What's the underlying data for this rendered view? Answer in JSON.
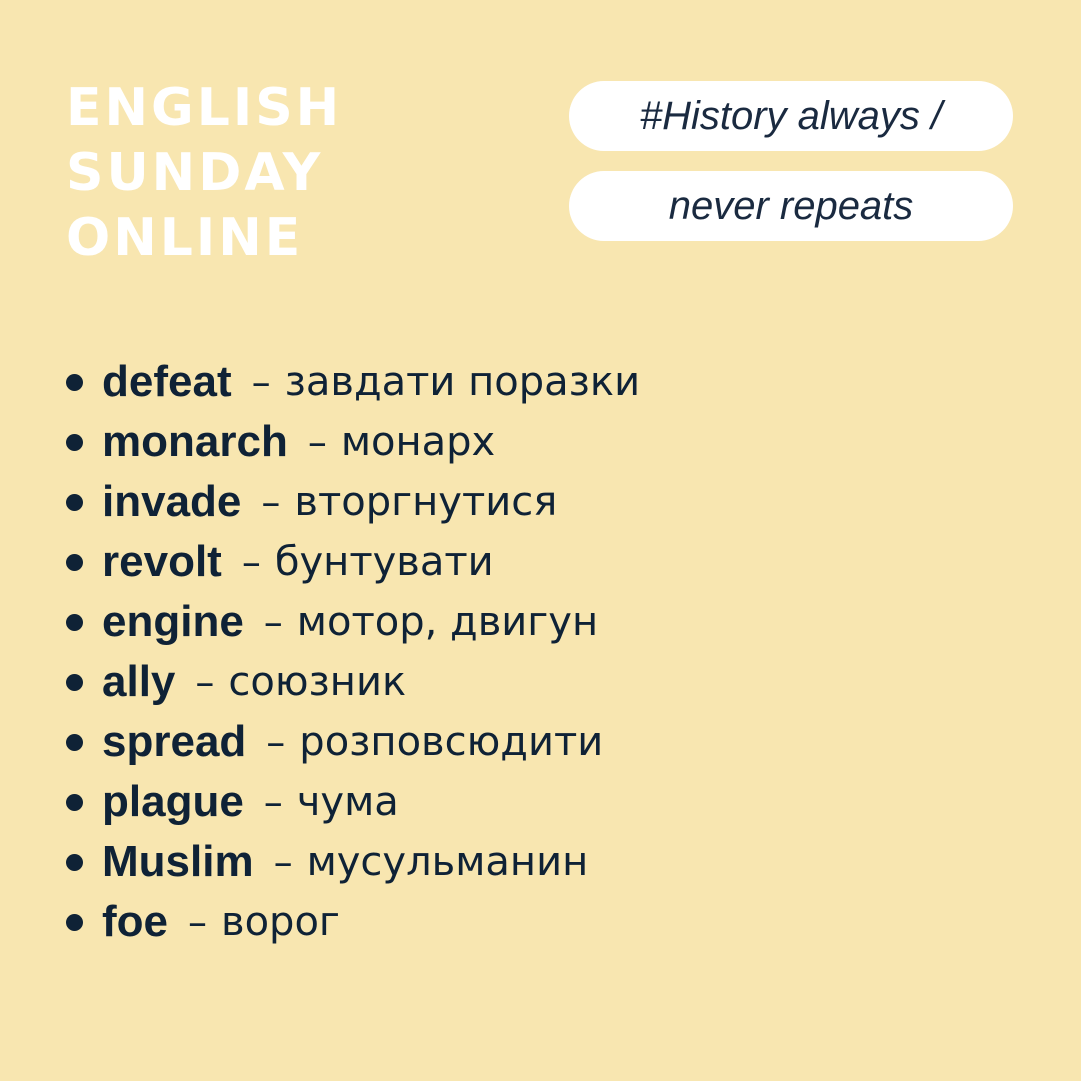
{
  "brand": {
    "lines": [
      "ENGLISH",
      "SUNDAY",
      "ONLINE"
    ]
  },
  "tags": {
    "line1": "#History always /",
    "line2": "never repeats"
  },
  "separator": "–",
  "vocab": [
    {
      "term": "defeat",
      "translation": "завдати поразки"
    },
    {
      "term": "monarch",
      "translation": "монарх"
    },
    {
      "term": "invade",
      "translation": "вторгнутися"
    },
    {
      "term": "revolt",
      "translation": "бунтувати"
    },
    {
      "term": "engine",
      "translation": "мотор, двигун"
    },
    {
      "term": "ally",
      "translation": "союзник"
    },
    {
      "term": "spread",
      "translation": "розповсюдити"
    },
    {
      "term": "plague",
      "translation": "чума"
    },
    {
      "term": "Muslim",
      "translation": "мусульманин"
    },
    {
      "term": "foe",
      "translation": "ворог"
    }
  ],
  "colors": {
    "background": "#f8e6b0",
    "text": "#0f2236",
    "brand": "#ffffff",
    "pill": "#ffffff"
  }
}
